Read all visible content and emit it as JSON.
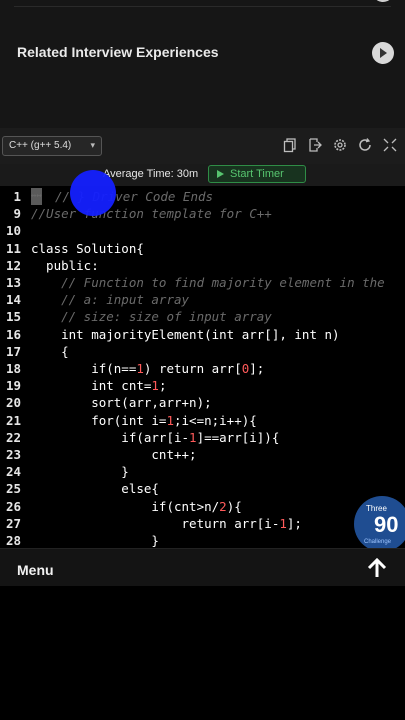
{
  "related": {
    "title": "Related Interview Experiences"
  },
  "toolbar": {
    "language": "C++ (g++ 5.4)",
    "icons": [
      "copy-icon",
      "export-icon",
      "settings-icon",
      "refresh-icon",
      "fullscreen-icon"
    ]
  },
  "timer": {
    "avg_label": "Average Time: 30m",
    "start_label": "Start Timer"
  },
  "editor": {
    "lines": [
      {
        "n": "1",
        "text": "// } Driver Code Ends",
        "style": "fold"
      },
      {
        "n": "9",
        "text": "//User function template for C++",
        "style": "comment"
      },
      {
        "n": "10",
        "text": "",
        "style": "code"
      },
      {
        "n": "11",
        "text": "class Solution{",
        "style": "code"
      },
      {
        "n": "12",
        "text": "  public:",
        "style": "code"
      },
      {
        "n": "13",
        "text": "    // Function to find majority element in the",
        "style": "comment"
      },
      {
        "n": "14",
        "text": "    // a: input array",
        "style": "comment"
      },
      {
        "n": "15",
        "text": "    // size: size of input array",
        "style": "comment"
      },
      {
        "n": "16",
        "text": "    int majorityElement(int arr[], int n)",
        "style": "code"
      },
      {
        "n": "17",
        "text": "    {",
        "style": "code"
      },
      {
        "n": "18",
        "text": "        if(n==1) return arr[0];",
        "style": "code"
      },
      {
        "n": "19",
        "text": "        int cnt=1;",
        "style": "code"
      },
      {
        "n": "20",
        "text": "        sort(arr,arr+n);",
        "style": "code"
      },
      {
        "n": "21",
        "text": "        for(int i=1;i<=n;i++){",
        "style": "code"
      },
      {
        "n": "22",
        "text": "            if(arr[i-1]==arr[i]){",
        "style": "code"
      },
      {
        "n": "23",
        "text": "                cnt++;",
        "style": "code"
      },
      {
        "n": "24",
        "text": "            }",
        "style": "code"
      },
      {
        "n": "25",
        "text": "            else{",
        "style": "code"
      },
      {
        "n": "26",
        "text": "                if(cnt>n/2){",
        "style": "code"
      },
      {
        "n": "27",
        "text": "                    return arr[i-1];",
        "style": "code"
      },
      {
        "n": "28",
        "text": "                }",
        "style": "code"
      }
    ]
  },
  "badge": {
    "top": "Three",
    "num": "90",
    "sub": "Challenge"
  },
  "menu": {
    "label": "Menu"
  }
}
